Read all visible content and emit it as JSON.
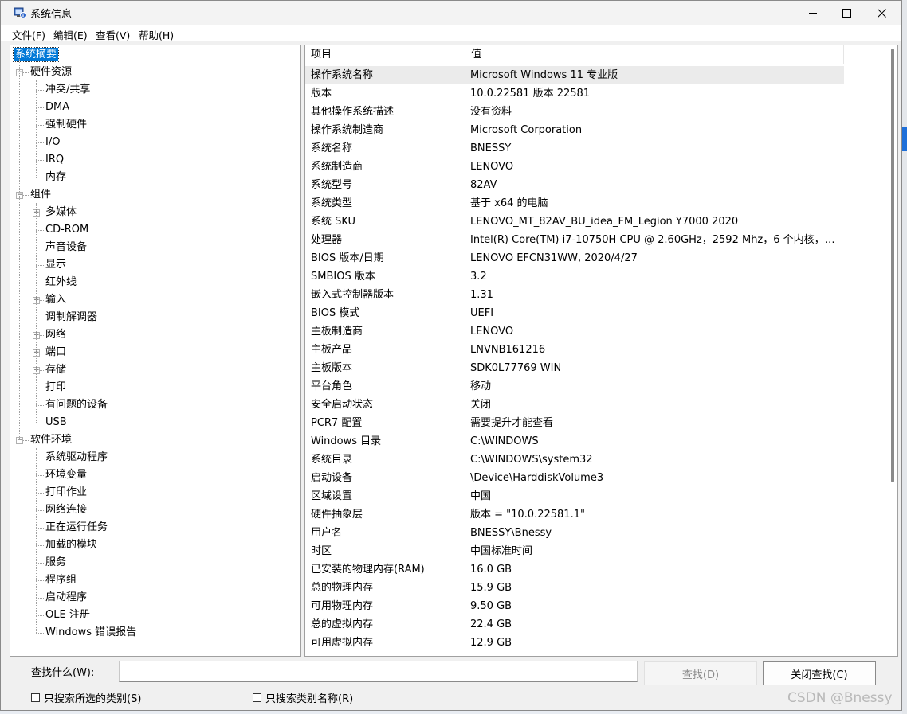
{
  "window": {
    "title": "系统信息",
    "icon": "system-info-icon"
  },
  "menubar": {
    "items": [
      "文件(F)",
      "编辑(E)",
      "查看(V)",
      "帮助(H)"
    ]
  },
  "tree": {
    "root": "系统摘要",
    "nodes": [
      {
        "label": "硬件资源",
        "level": 1,
        "expander": true
      },
      {
        "label": "冲突/共享",
        "level": 2
      },
      {
        "label": "DMA",
        "level": 2
      },
      {
        "label": "强制硬件",
        "level": 2
      },
      {
        "label": "I/O",
        "level": 2
      },
      {
        "label": "IRQ",
        "level": 2
      },
      {
        "label": "内存",
        "level": 2
      },
      {
        "label": "组件",
        "level": 1,
        "expander": true
      },
      {
        "label": "多媒体",
        "level": 2,
        "expander": true
      },
      {
        "label": "CD-ROM",
        "level": 2
      },
      {
        "label": "声音设备",
        "level": 2
      },
      {
        "label": "显示",
        "level": 2
      },
      {
        "label": "红外线",
        "level": 2
      },
      {
        "label": "输入",
        "level": 2,
        "expander": true
      },
      {
        "label": "调制解调器",
        "level": 2
      },
      {
        "label": "网络",
        "level": 2,
        "expander": true
      },
      {
        "label": "端口",
        "level": 2,
        "expander": true
      },
      {
        "label": "存储",
        "level": 2,
        "expander": true
      },
      {
        "label": "打印",
        "level": 2
      },
      {
        "label": "有问题的设备",
        "level": 2
      },
      {
        "label": "USB",
        "level": 2
      },
      {
        "label": "软件环境",
        "level": 1,
        "expander": true
      },
      {
        "label": "系统驱动程序",
        "level": 2
      },
      {
        "label": "环境变量",
        "level": 2
      },
      {
        "label": "打印作业",
        "level": 2
      },
      {
        "label": "网络连接",
        "level": 2
      },
      {
        "label": "正在运行任务",
        "level": 2
      },
      {
        "label": "加载的模块",
        "level": 2
      },
      {
        "label": "服务",
        "level": 2
      },
      {
        "label": "程序组",
        "level": 2
      },
      {
        "label": "启动程序",
        "level": 2
      },
      {
        "label": "OLE 注册",
        "level": 2
      },
      {
        "label": "Windows 错误报告",
        "level": 2
      }
    ]
  },
  "list": {
    "columns": [
      "项目",
      "值"
    ],
    "rows": [
      [
        "操作系统名称",
        "Microsoft Windows 11 专业版"
      ],
      [
        "版本",
        "10.0.22581 版本 22581"
      ],
      [
        "其他操作系统描述",
        "没有资料"
      ],
      [
        "操作系统制造商",
        "Microsoft Corporation"
      ],
      [
        "系统名称",
        "BNESSY"
      ],
      [
        "系统制造商",
        "LENOVO"
      ],
      [
        "系统型号",
        "82AV"
      ],
      [
        "系统类型",
        "基于 x64 的电脑"
      ],
      [
        "系统 SKU",
        "LENOVO_MT_82AV_BU_idea_FM_Legion Y7000 2020"
      ],
      [
        "处理器",
        "Intel(R) Core(TM) i7-10750H CPU @ 2.60GHz，2592 Mhz，6 个内核，12 ..."
      ],
      [
        "BIOS 版本/日期",
        "LENOVO EFCN31WW, 2020/4/27"
      ],
      [
        "SMBIOS 版本",
        "3.2"
      ],
      [
        "嵌入式控制器版本",
        "1.31"
      ],
      [
        "BIOS 模式",
        "UEFI"
      ],
      [
        "主板制造商",
        "LENOVO"
      ],
      [
        "主板产品",
        "LNVNB161216"
      ],
      [
        "主板版本",
        "SDK0L77769 WIN"
      ],
      [
        "平台角色",
        "移动"
      ],
      [
        "安全启动状态",
        "关闭"
      ],
      [
        "PCR7 配置",
        "需要提升才能查看"
      ],
      [
        "Windows 目录",
        "C:\\WINDOWS"
      ],
      [
        "系统目录",
        "C:\\WINDOWS\\system32"
      ],
      [
        "启动设备",
        "\\Device\\HarddiskVolume3"
      ],
      [
        "区域设置",
        "中国"
      ],
      [
        "硬件抽象层",
        "版本 = \"10.0.22581.1\""
      ],
      [
        "用户名",
        "BNESSY\\Bnessy"
      ],
      [
        "时区",
        "中国标准时间"
      ],
      [
        "已安装的物理内存(RAM)",
        "16.0 GB"
      ],
      [
        "总的物理内存",
        "15.9 GB"
      ],
      [
        "可用物理内存",
        "9.50 GB"
      ],
      [
        "总的虚拟内存",
        "22.4 GB"
      ],
      [
        "可用虚拟内存",
        "12.9 GB"
      ]
    ]
  },
  "find": {
    "label": "查找什么(W):",
    "value": "",
    "find_button": "查找(D)",
    "close_button": "关闭查找(C)",
    "check_selected": "只搜索所选的类别(S)",
    "check_names": "只搜索类别名称(R)"
  },
  "watermark": "CSDN @Bnessy"
}
